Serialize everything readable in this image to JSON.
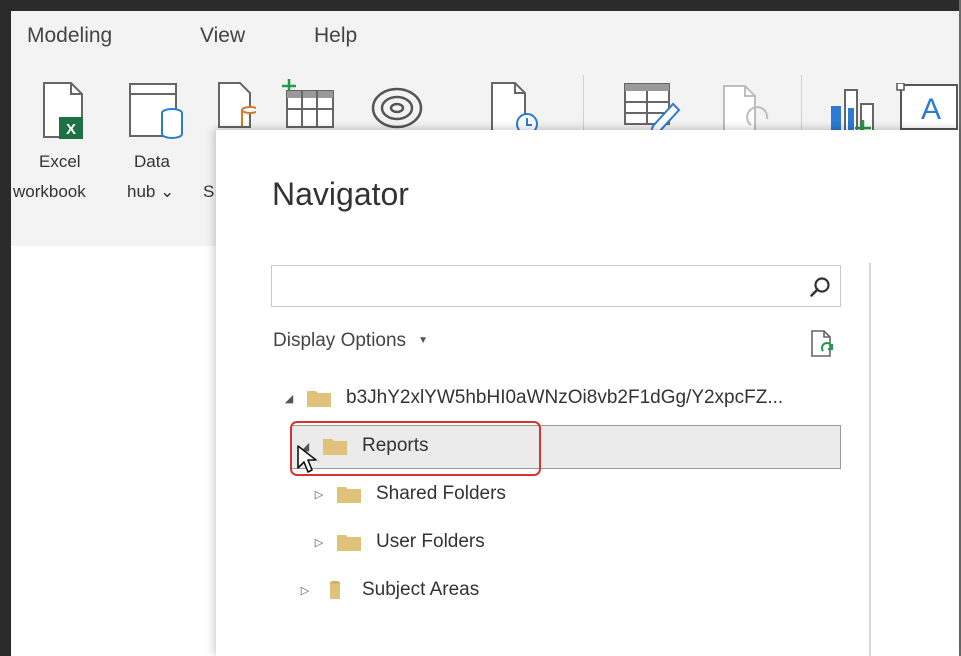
{
  "menu": [
    {
      "label": "Modeling"
    },
    {
      "label": "View"
    },
    {
      "label": "Help"
    }
  ],
  "ribbon": {
    "excel_workbook": {
      "line1": "Excel",
      "line2": "workbook"
    },
    "data_hub": {
      "line1": "Data",
      "line2": "hub ⌄"
    },
    "partial_label": "S"
  },
  "navigator": {
    "title": "Navigator",
    "search": {
      "value": "",
      "placeholder": ""
    },
    "display_options": "Display Options",
    "tree": {
      "root": {
        "label": "b3JhY2xlYW5hbHI0aWNzOi8vb2F1dGg/Y2xpcFZ...",
        "expanded": true
      },
      "reports": {
        "label": "Reports",
        "expanded": true,
        "selected": true
      },
      "shared_folders": {
        "label": "Shared Folders",
        "expanded": false
      },
      "user_folders": {
        "label": "User Folders",
        "expanded": false
      },
      "subject_areas": {
        "label": "Subject Areas",
        "expanded": false
      }
    }
  },
  "colors": {
    "folder": "#e0c27a",
    "excel_green": "#1e7145",
    "highlight_border": "#d9342b",
    "selection_bg": "#ebebeb",
    "accent_blue": "#2b7cd3"
  },
  "icons": {
    "excel": "excel-icon",
    "data_hub": "data-hub-icon",
    "sql": "sql-server-icon",
    "table": "enter-data-table-icon",
    "dataverse": "dataverse-icon",
    "recent": "recent-sources-icon",
    "transform": "transform-data-icon",
    "refresh": "refresh-icon",
    "visual": "new-visual-icon",
    "textbox": "text-box-icon",
    "search": "search-icon",
    "folder": "folder-icon",
    "cursor": "cursor-pointer-icon"
  }
}
